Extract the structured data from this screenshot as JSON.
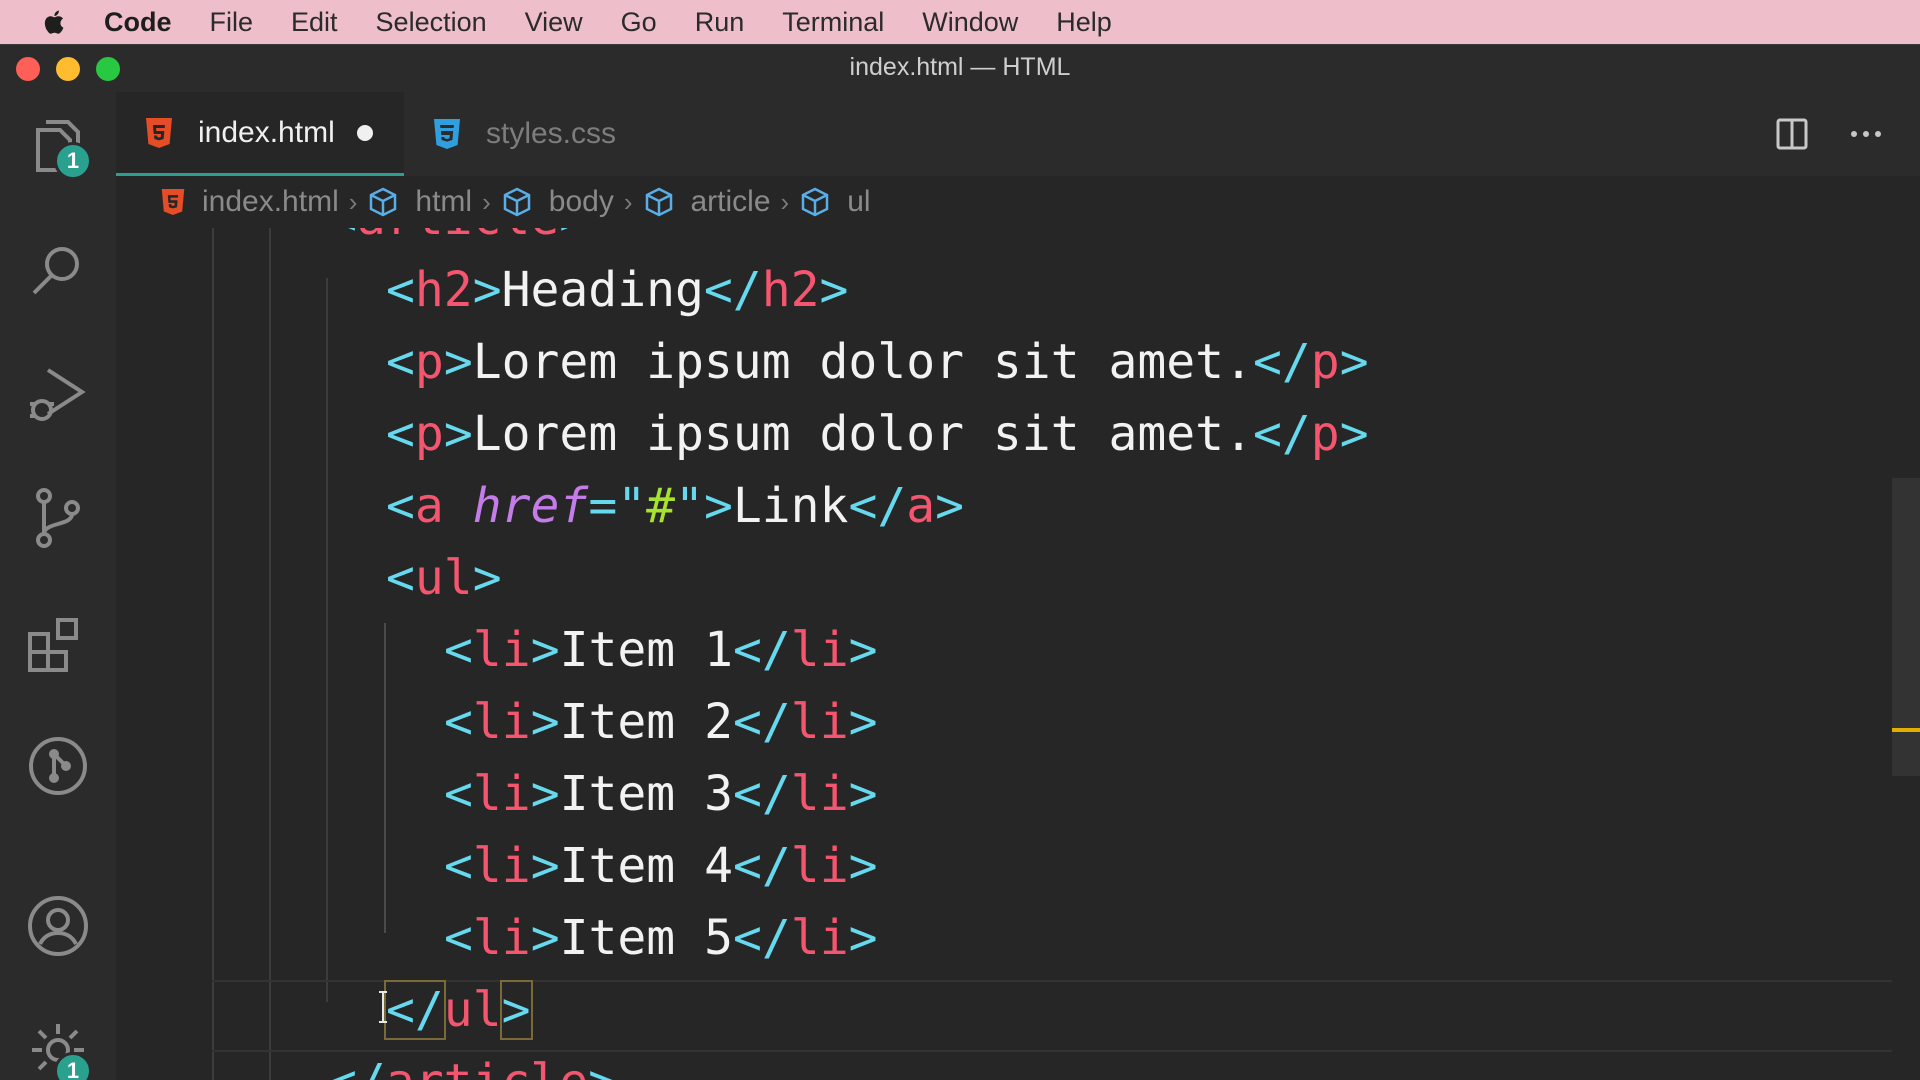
{
  "menubar": {
    "app": "Code",
    "items": [
      "File",
      "Edit",
      "Selection",
      "View",
      "Go",
      "Run",
      "Terminal",
      "Window",
      "Help"
    ]
  },
  "window": {
    "title": "index.html — HTML"
  },
  "activity_bar": {
    "explorer_badge": "1",
    "settings_badge": "1",
    "icons": [
      "files-icon",
      "search-icon",
      "run-debug-icon",
      "source-control-icon",
      "extensions-icon",
      "git-graph-icon",
      "account-icon",
      "settings-gear-icon"
    ]
  },
  "tabs": [
    {
      "label": "index.html",
      "active": true,
      "modified": true,
      "icon": "html5-icon"
    },
    {
      "label": "styles.css",
      "active": false,
      "modified": false,
      "icon": "css3-icon"
    }
  ],
  "breadcrumb": [
    "index.html",
    "html",
    "body",
    "article",
    "ul"
  ],
  "editor": {
    "lines": [
      [
        [
          "br",
          "<"
        ],
        [
          "tag",
          "article"
        ],
        [
          "br",
          ">"
        ]
      ],
      [
        [
          "br",
          "<"
        ],
        [
          "tag",
          "h2"
        ],
        [
          "br",
          ">"
        ],
        [
          "txt",
          "Heading"
        ],
        [
          "br",
          "</"
        ],
        [
          "tag",
          "h2"
        ],
        [
          "br",
          ">"
        ]
      ],
      [
        [
          "br",
          "<"
        ],
        [
          "tag",
          "p"
        ],
        [
          "br",
          ">"
        ],
        [
          "txt",
          "Lorem ipsum dolor sit amet."
        ],
        [
          "br",
          "</"
        ],
        [
          "tag",
          "p"
        ],
        [
          "br",
          ">"
        ]
      ],
      [
        [
          "br",
          "<"
        ],
        [
          "tag",
          "p"
        ],
        [
          "br",
          ">"
        ],
        [
          "txt",
          "Lorem ipsum dolor sit amet."
        ],
        [
          "br",
          "</"
        ],
        [
          "tag",
          "p"
        ],
        [
          "br",
          ">"
        ]
      ],
      [
        [
          "br",
          "<"
        ],
        [
          "tag",
          "a"
        ],
        [
          "txt",
          " "
        ],
        [
          "attr",
          "href"
        ],
        [
          "br",
          "="
        ],
        [
          "br",
          "\""
        ],
        [
          "str",
          "#"
        ],
        [
          "br",
          "\""
        ],
        [
          "br",
          ">"
        ],
        [
          "txt",
          "Link"
        ],
        [
          "br",
          "</"
        ],
        [
          "tag",
          "a"
        ],
        [
          "br",
          ">"
        ]
      ],
      [
        [
          "br",
          "<"
        ],
        [
          "tag",
          "ul"
        ],
        [
          "br",
          ">"
        ]
      ],
      [
        [
          "br",
          "<"
        ],
        [
          "tag",
          "li"
        ],
        [
          "br",
          ">"
        ],
        [
          "txt",
          "Item 1"
        ],
        [
          "br",
          "</"
        ],
        [
          "tag",
          "li"
        ],
        [
          "br",
          ">"
        ]
      ],
      [
        [
          "br",
          "<"
        ],
        [
          "tag",
          "li"
        ],
        [
          "br",
          ">"
        ],
        [
          "txt",
          "Item 2"
        ],
        [
          "br",
          "</"
        ],
        [
          "tag",
          "li"
        ],
        [
          "br",
          ">"
        ]
      ],
      [
        [
          "br",
          "<"
        ],
        [
          "tag",
          "li"
        ],
        [
          "br",
          ">"
        ],
        [
          "txt",
          "Item 3"
        ],
        [
          "br",
          "</"
        ],
        [
          "tag",
          "li"
        ],
        [
          "br",
          ">"
        ]
      ],
      [
        [
          "br",
          "<"
        ],
        [
          "tag",
          "li"
        ],
        [
          "br",
          ">"
        ],
        [
          "txt",
          "Item 4"
        ],
        [
          "br",
          "</"
        ],
        [
          "tag",
          "li"
        ],
        [
          "br",
          ">"
        ]
      ],
      [
        [
          "br",
          "<"
        ],
        [
          "tag",
          "li"
        ],
        [
          "br",
          ">"
        ],
        [
          "txt",
          "Item 5"
        ],
        [
          "br",
          "</"
        ],
        [
          "tag",
          "li"
        ],
        [
          "br",
          ">"
        ]
      ],
      [
        [
          "br",
          "</"
        ],
        [
          "tag",
          "ul"
        ],
        [
          "br",
          ">"
        ]
      ],
      [
        [
          "br",
          "</"
        ],
        [
          "tag",
          "article"
        ],
        [
          "br",
          ">"
        ]
      ]
    ],
    "indent_levels": [
      0,
      1,
      1,
      1,
      1,
      1,
      2,
      2,
      2,
      2,
      2,
      1,
      0
    ],
    "current_line": 12
  },
  "colors": {
    "bracket": "#66d9ef",
    "tag": "#f5566f",
    "attribute": "#c47ce8",
    "string": "#a6e22e",
    "text": "#f2f2f2",
    "accent": "#2aa18f"
  }
}
